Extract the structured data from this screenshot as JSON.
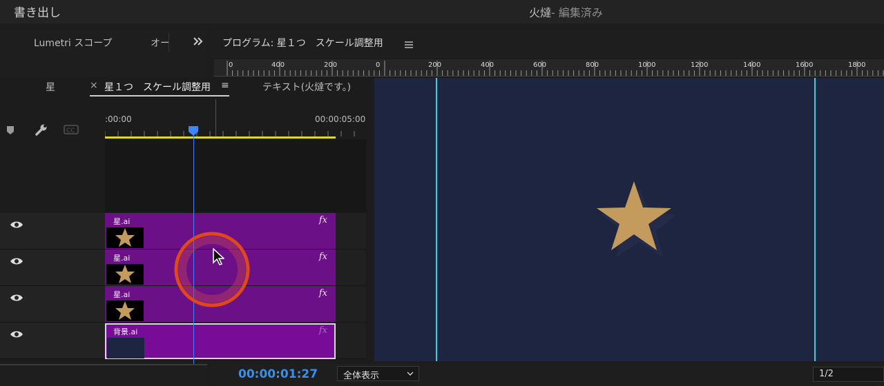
{
  "window": {
    "export_label": "書き出し",
    "title_main": "火燵",
    "title_sub": "- 編集済み"
  },
  "left_panel": {
    "tabs": [
      "Lumetri スコープ",
      "オー"
    ],
    "overflow_icon": "double-chevron-right-icon"
  },
  "program": {
    "title": "プログラム: 星１つ　スケール調整用",
    "menu_icon": "hamburger-menu-icon",
    "ruler_labels": [
      "0",
      "400",
      "200",
      "0",
      "200",
      "400",
      "600",
      "800",
      "1000",
      "1200",
      "1400",
      "1600",
      "1800"
    ]
  },
  "timeline": {
    "tabs": {
      "first": "星",
      "close": "×",
      "active": "星１つ　スケール調整用",
      "menu": "≡",
      "other": "テキスト(火燵です。)"
    },
    "ruler": {
      "start": ":00:00",
      "end": "00:00:05:00"
    },
    "tools": [
      "marker-icon",
      "wrench-icon",
      "closed-captions-icon"
    ],
    "tracks": [
      {
        "clip": "星.ai",
        "fx": "fx",
        "thumb": "star"
      },
      {
        "clip": "星.ai",
        "fx": "fx",
        "thumb": "star"
      },
      {
        "clip": "星.ai",
        "fx": "fx",
        "thumb": "star"
      },
      {
        "clip": "背景.ai",
        "fx": "fx",
        "thumb": "background",
        "selected": true
      }
    ]
  },
  "footer": {
    "timecode": "00:00:01:27",
    "fit": "全体表示",
    "page": "1/2"
  },
  "colors": {
    "clip": "#6b1087",
    "clip_selected": "#780b97",
    "accent_blue": "#3c8fe8",
    "guide": "#39d0dc",
    "viewer_bg": "#1e2541",
    "star": "#c49a5d",
    "work_area": "#e5d628"
  }
}
